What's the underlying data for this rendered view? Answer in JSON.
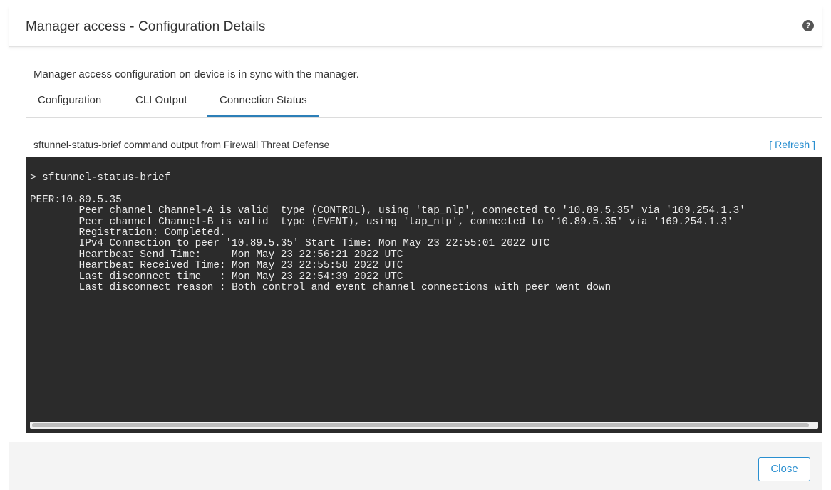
{
  "dialog": {
    "title": "Manager access - Configuration Details",
    "help_icon": "?",
    "sync_message": "Manager access configuration on device is in sync with the manager."
  },
  "tabs": [
    {
      "label": "Configuration",
      "active": false
    },
    {
      "label": "CLI Output",
      "active": false
    },
    {
      "label": "Connection Status",
      "active": true
    }
  ],
  "output": {
    "label": "sftunnel-status-brief command output from Firewall Threat Defense",
    "refresh_label": "[ Refresh ]",
    "lines": [
      "> sftunnel-status-brief",
      "",
      "PEER:10.89.5.35",
      "        Peer channel Channel-A is valid  type (CONTROL), using 'tap_nlp', connected to '10.89.5.35' via '169.254.1.3'",
      "        Peer channel Channel-B is valid  type (EVENT), using 'tap_nlp', connected to '10.89.5.35' via '169.254.1.3'",
      "        Registration: Completed.",
      "        IPv4 Connection to peer '10.89.5.35' Start Time: Mon May 23 22:55:01 2022 UTC",
      "        Heartbeat Send Time:     Mon May 23 22:56:21 2022 UTC",
      "        Heartbeat Received Time: Mon May 23 22:55:58 2022 UTC",
      "        Last disconnect time   : Mon May 23 22:54:39 2022 UTC",
      "        Last disconnect reason : Both control and event channel connections with peer went down"
    ]
  },
  "footer": {
    "close_label": "Close"
  },
  "colors": {
    "accent": "#2a8fd0",
    "tab_underline": "#2c7fb8",
    "terminal_bg": "#2b2b2b",
    "terminal_text": "#ececec"
  }
}
